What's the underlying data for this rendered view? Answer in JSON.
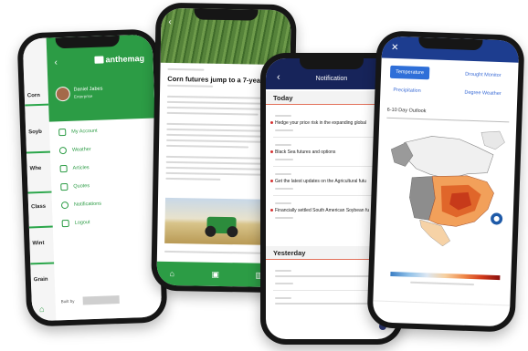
{
  "phone_menu": {
    "brand": "anthemag",
    "user_name": "Daniel Jabes",
    "user_role": "Enterprise",
    "menu_items": [
      "My Account",
      "Weather",
      "Articles",
      "Quotes",
      "Notifications",
      "Logout"
    ],
    "list_rows": [
      "Corn",
      "Soyb",
      "Whe",
      "Class",
      "Wint",
      "Grain"
    ],
    "footer_labels": [
      "Built by",
      "Glen"
    ],
    "brand_color": "#2c9c45"
  },
  "phone_article": {
    "headline": "Corn futures jump to a 7-year hi",
    "tabs": [
      "home-icon",
      "article-icon",
      "chart-icon"
    ]
  },
  "phone_notifications": {
    "title": "Notification",
    "today_label": "Today",
    "yesterday_label": "Yesterday",
    "notifications": [
      "Hedge your price risk in the expanding global",
      "Black Sea futures and options",
      "Get the latest updates on the Agricultural futu",
      "Financially settled South American Soybean fu"
    ],
    "nav_color": "#17245a"
  },
  "phone_map": {
    "tabs": [
      "Temperature",
      "Precipitation",
      "Drought Monitor",
      "Degree Weather"
    ],
    "active_tab": "Temperature",
    "dropdown": "6-10 Day Outlook",
    "nav_color": "#1d3d8f"
  }
}
